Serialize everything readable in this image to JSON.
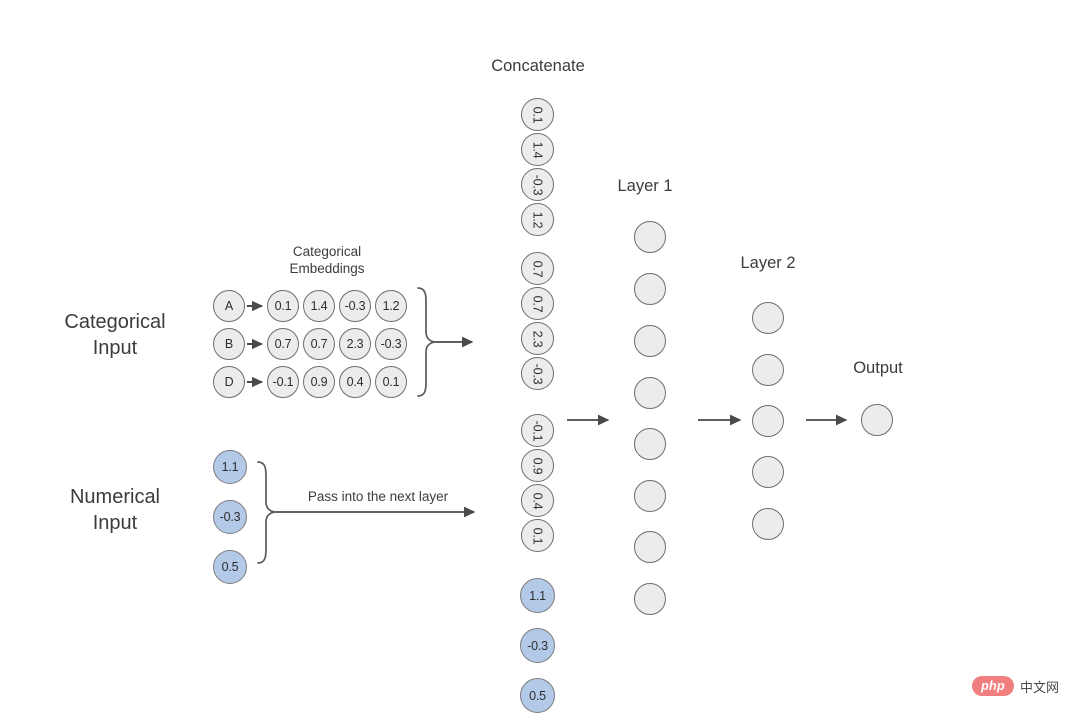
{
  "diagram": {
    "title_concatenate": "Concatenate",
    "label_categorical_input": "Categorical\nInput",
    "label_numerical_input": "Numerical\nInput",
    "label_categorical_embeddings": "Categorical\nEmbeddings",
    "label_pass_next_layer": "Pass into the next layer",
    "label_layer1": "Layer 1",
    "label_layer2": "Layer 2",
    "label_output": "Output"
  },
  "categorical": {
    "categories": [
      "A",
      "B",
      "D"
    ],
    "embeddings": [
      [
        "0.1",
        "1.4",
        "-0.3",
        "1.2"
      ],
      [
        "0.7",
        "0.7",
        "2.3",
        "-0.3"
      ],
      [
        "-0.1",
        "0.9",
        "0.4",
        "0.1"
      ]
    ]
  },
  "numerical": {
    "values": [
      "1.1",
      "-0.3",
      "0.5"
    ]
  },
  "concatenate": {
    "gray_values": [
      "0.1",
      "1.4",
      "-0.3",
      "1.2",
      "0.7",
      "0.7",
      "2.3",
      "-0.3",
      "-0.1",
      "0.9",
      "0.4",
      "0.1"
    ],
    "blue_values": [
      "1.1",
      "-0.3",
      "0.5"
    ]
  },
  "network": {
    "layer1_node_count": 8,
    "layer2_node_count": 5,
    "output_node_count": 1
  },
  "colors": {
    "node_gray_fill": "#ececec",
    "node_blue_fill": "#b3c9e8",
    "node_border": "#6e6e6e",
    "stroke": "#555555",
    "text": "#3c3c3c",
    "watermark_badge": "#f27f7f"
  },
  "watermark": {
    "badge": "php",
    "text": "中文网"
  }
}
